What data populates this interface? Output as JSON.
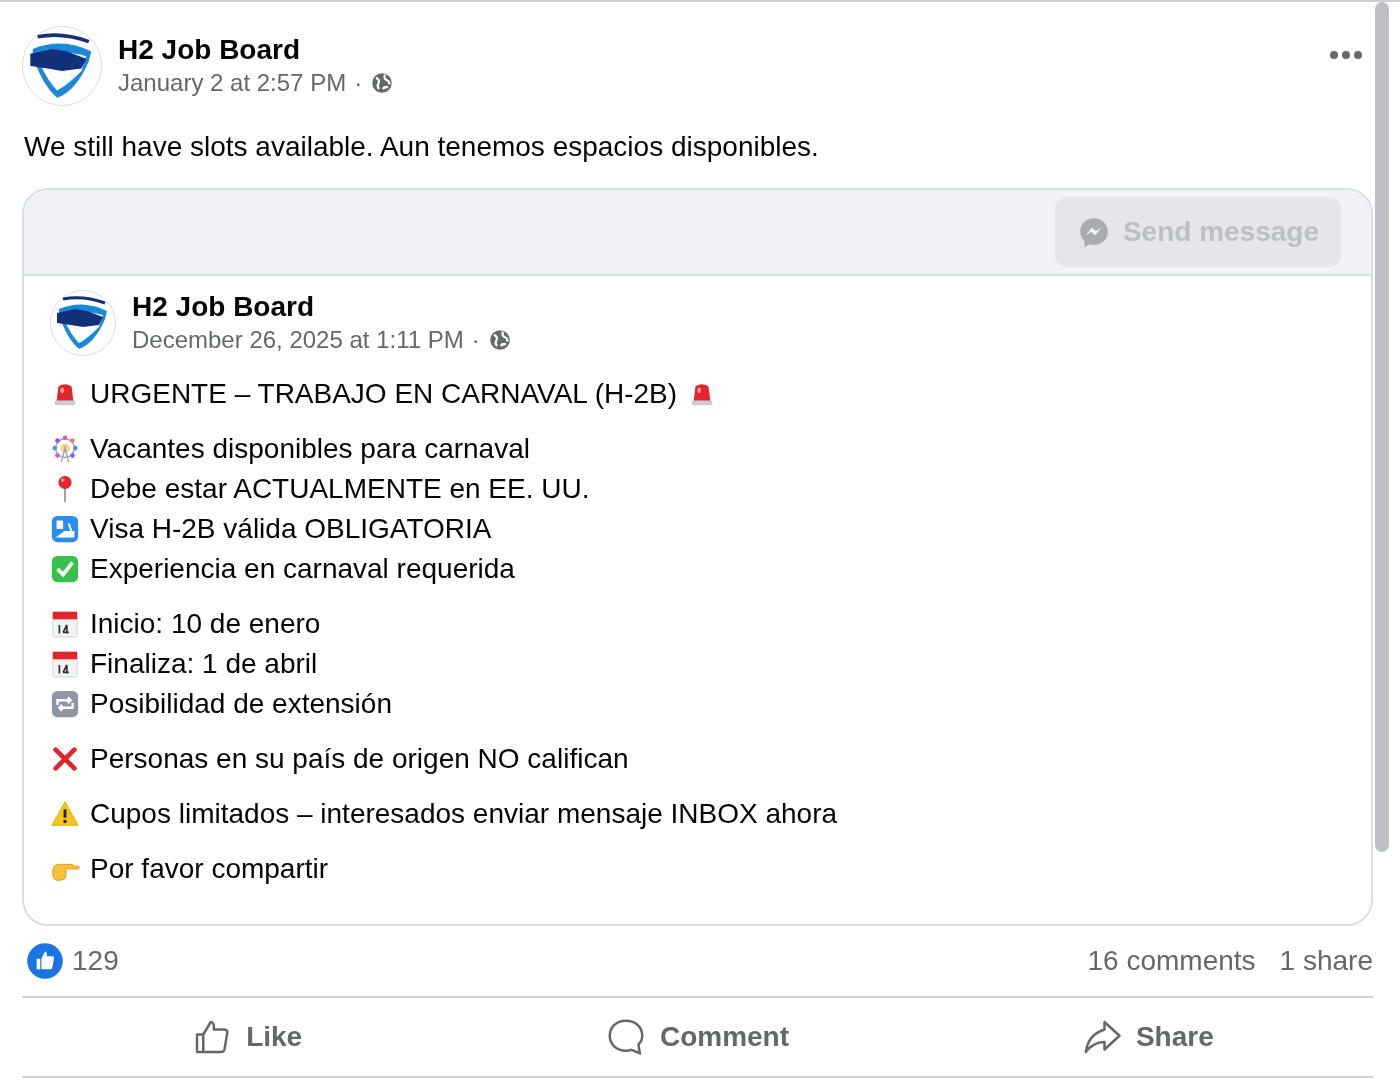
{
  "post": {
    "author": "H2 Job Board",
    "timestamp": "January 2 at 2:57 PM",
    "separator": "·",
    "text": "We still have slots available. Aun tenemos espacios disponibles."
  },
  "shared_post": {
    "send_button": {
      "label": "Send message",
      "disabled": true
    },
    "author": "H2 Job Board",
    "timestamp": "December 26, 2025 at 1:11 PM",
    "separator": "·",
    "paragraphs": [
      [
        {
          "kind": "siren",
          "text": "URGENTE – TRABAJO EN CARNAVAL (H-2B)",
          "icon_after": true
        }
      ],
      [
        {
          "kind": "ferris-wheel",
          "text": "Vacantes disponibles para carnaval"
        },
        {
          "kind": "pin",
          "text": "Debe estar ACTUALMENTE en EE. UU."
        },
        {
          "kind": "passport",
          "text": "Visa H-2B válida OBLIGATORIA"
        },
        {
          "kind": "check",
          "text": "Experiencia en carnaval requerida"
        }
      ],
      [
        {
          "kind": "calendar",
          "text": "Inicio: 10 de enero"
        },
        {
          "kind": "calendar",
          "text": "Finaliza: 1 de abril"
        },
        {
          "kind": "repeat",
          "text": "Posibilidad de extensión"
        }
      ],
      [
        {
          "kind": "cross",
          "text": "Personas en su país de origen NO califican"
        }
      ],
      [
        {
          "kind": "warning",
          "text": "Cupos limitados – interesados enviar mensaje INBOX ahora"
        }
      ],
      [
        {
          "kind": "pointing",
          "text": "Por favor compartir"
        }
      ]
    ]
  },
  "stats": {
    "likes": "129",
    "comments": "16 comments",
    "shares": "1 share"
  },
  "actions": [
    {
      "kind": "like",
      "label": "Like"
    },
    {
      "kind": "comment",
      "label": "Comment"
    },
    {
      "kind": "share",
      "label": "Share"
    }
  ]
}
